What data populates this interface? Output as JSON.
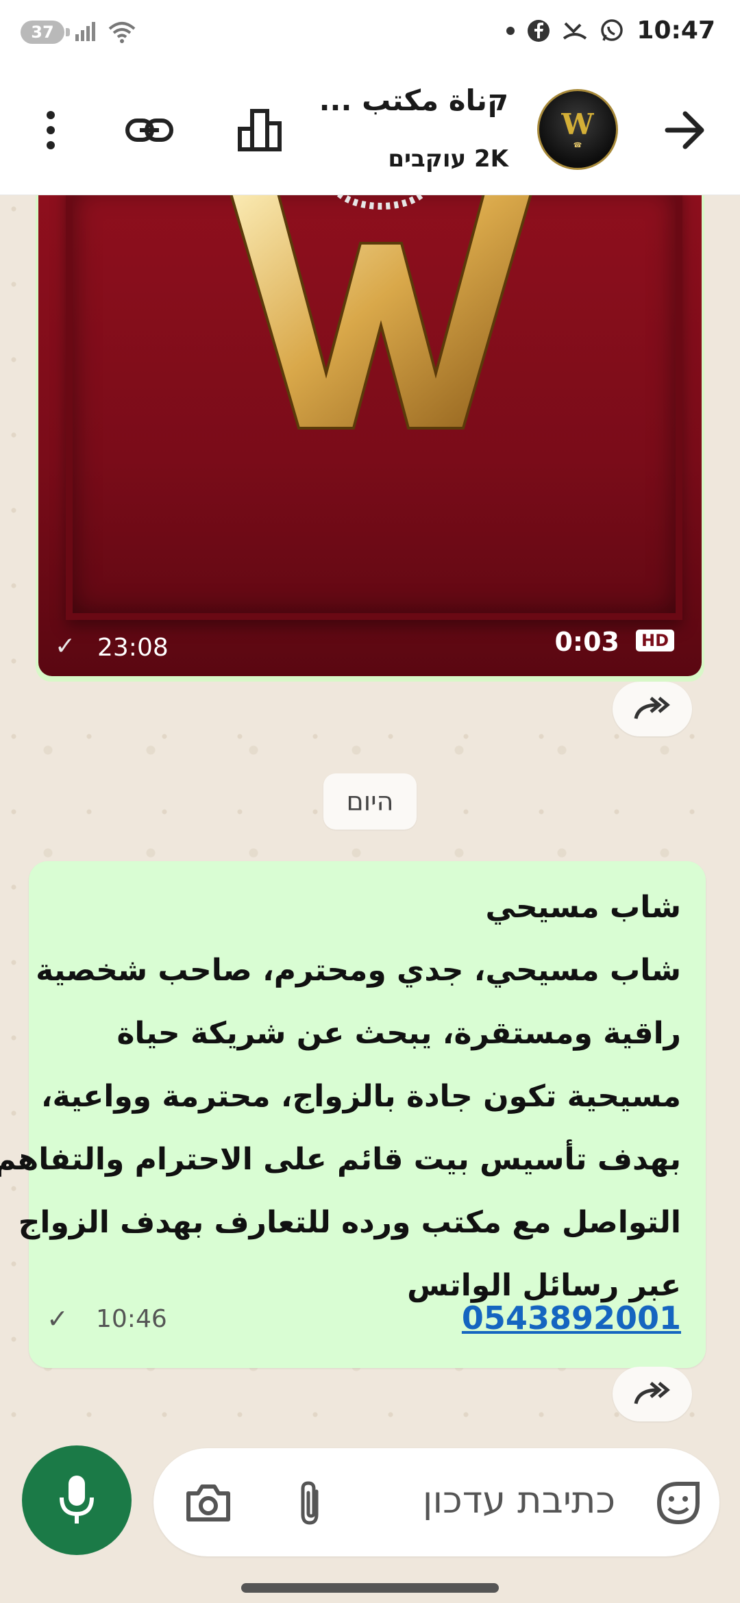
{
  "status_bar": {
    "battery": "37",
    "time": "10:47",
    "icons": [
      "signal-icon",
      "wifi-icon",
      "notification-dot",
      "facebook-icon",
      "missed-call-icon",
      "whatsapp-icon"
    ]
  },
  "header": {
    "title": "קناة مكتب ...",
    "subtitle": "2K עוקבים",
    "icons": [
      "back-arrow-icon",
      "channel-avatar",
      "poll-icon",
      "link-icon",
      "more-vert-icon"
    ]
  },
  "video_message": {
    "time": "23:08",
    "duration": "0:03",
    "hd_label": "HD"
  },
  "day_separator": "היום",
  "text_message": {
    "lines": [
      "شاب مسيحي",
      "شاب مسيحي، جدي ومحترم، صاحب شخصية",
      "راقية ومستقرة، يبحث عن شريكة حياة",
      "مسيحية تكون جادة بالزواج، محترمة وواعية،",
      "بهدف تأسيس بيت قائم على الاحترام والتفاهم",
      "التواصل مع مكتب ورده للتعارف بهدف الزواج",
      "عبر رسائل الواتس"
    ],
    "phone": "0543892001",
    "time": "10:46"
  },
  "composer": {
    "placeholder": "כתיבת עדכון"
  },
  "colors": {
    "accent_green": "#1b7a47",
    "bubble_green": "#d9fdd3",
    "link_blue": "#1565c0",
    "chat_bg": "#efe7dc"
  }
}
